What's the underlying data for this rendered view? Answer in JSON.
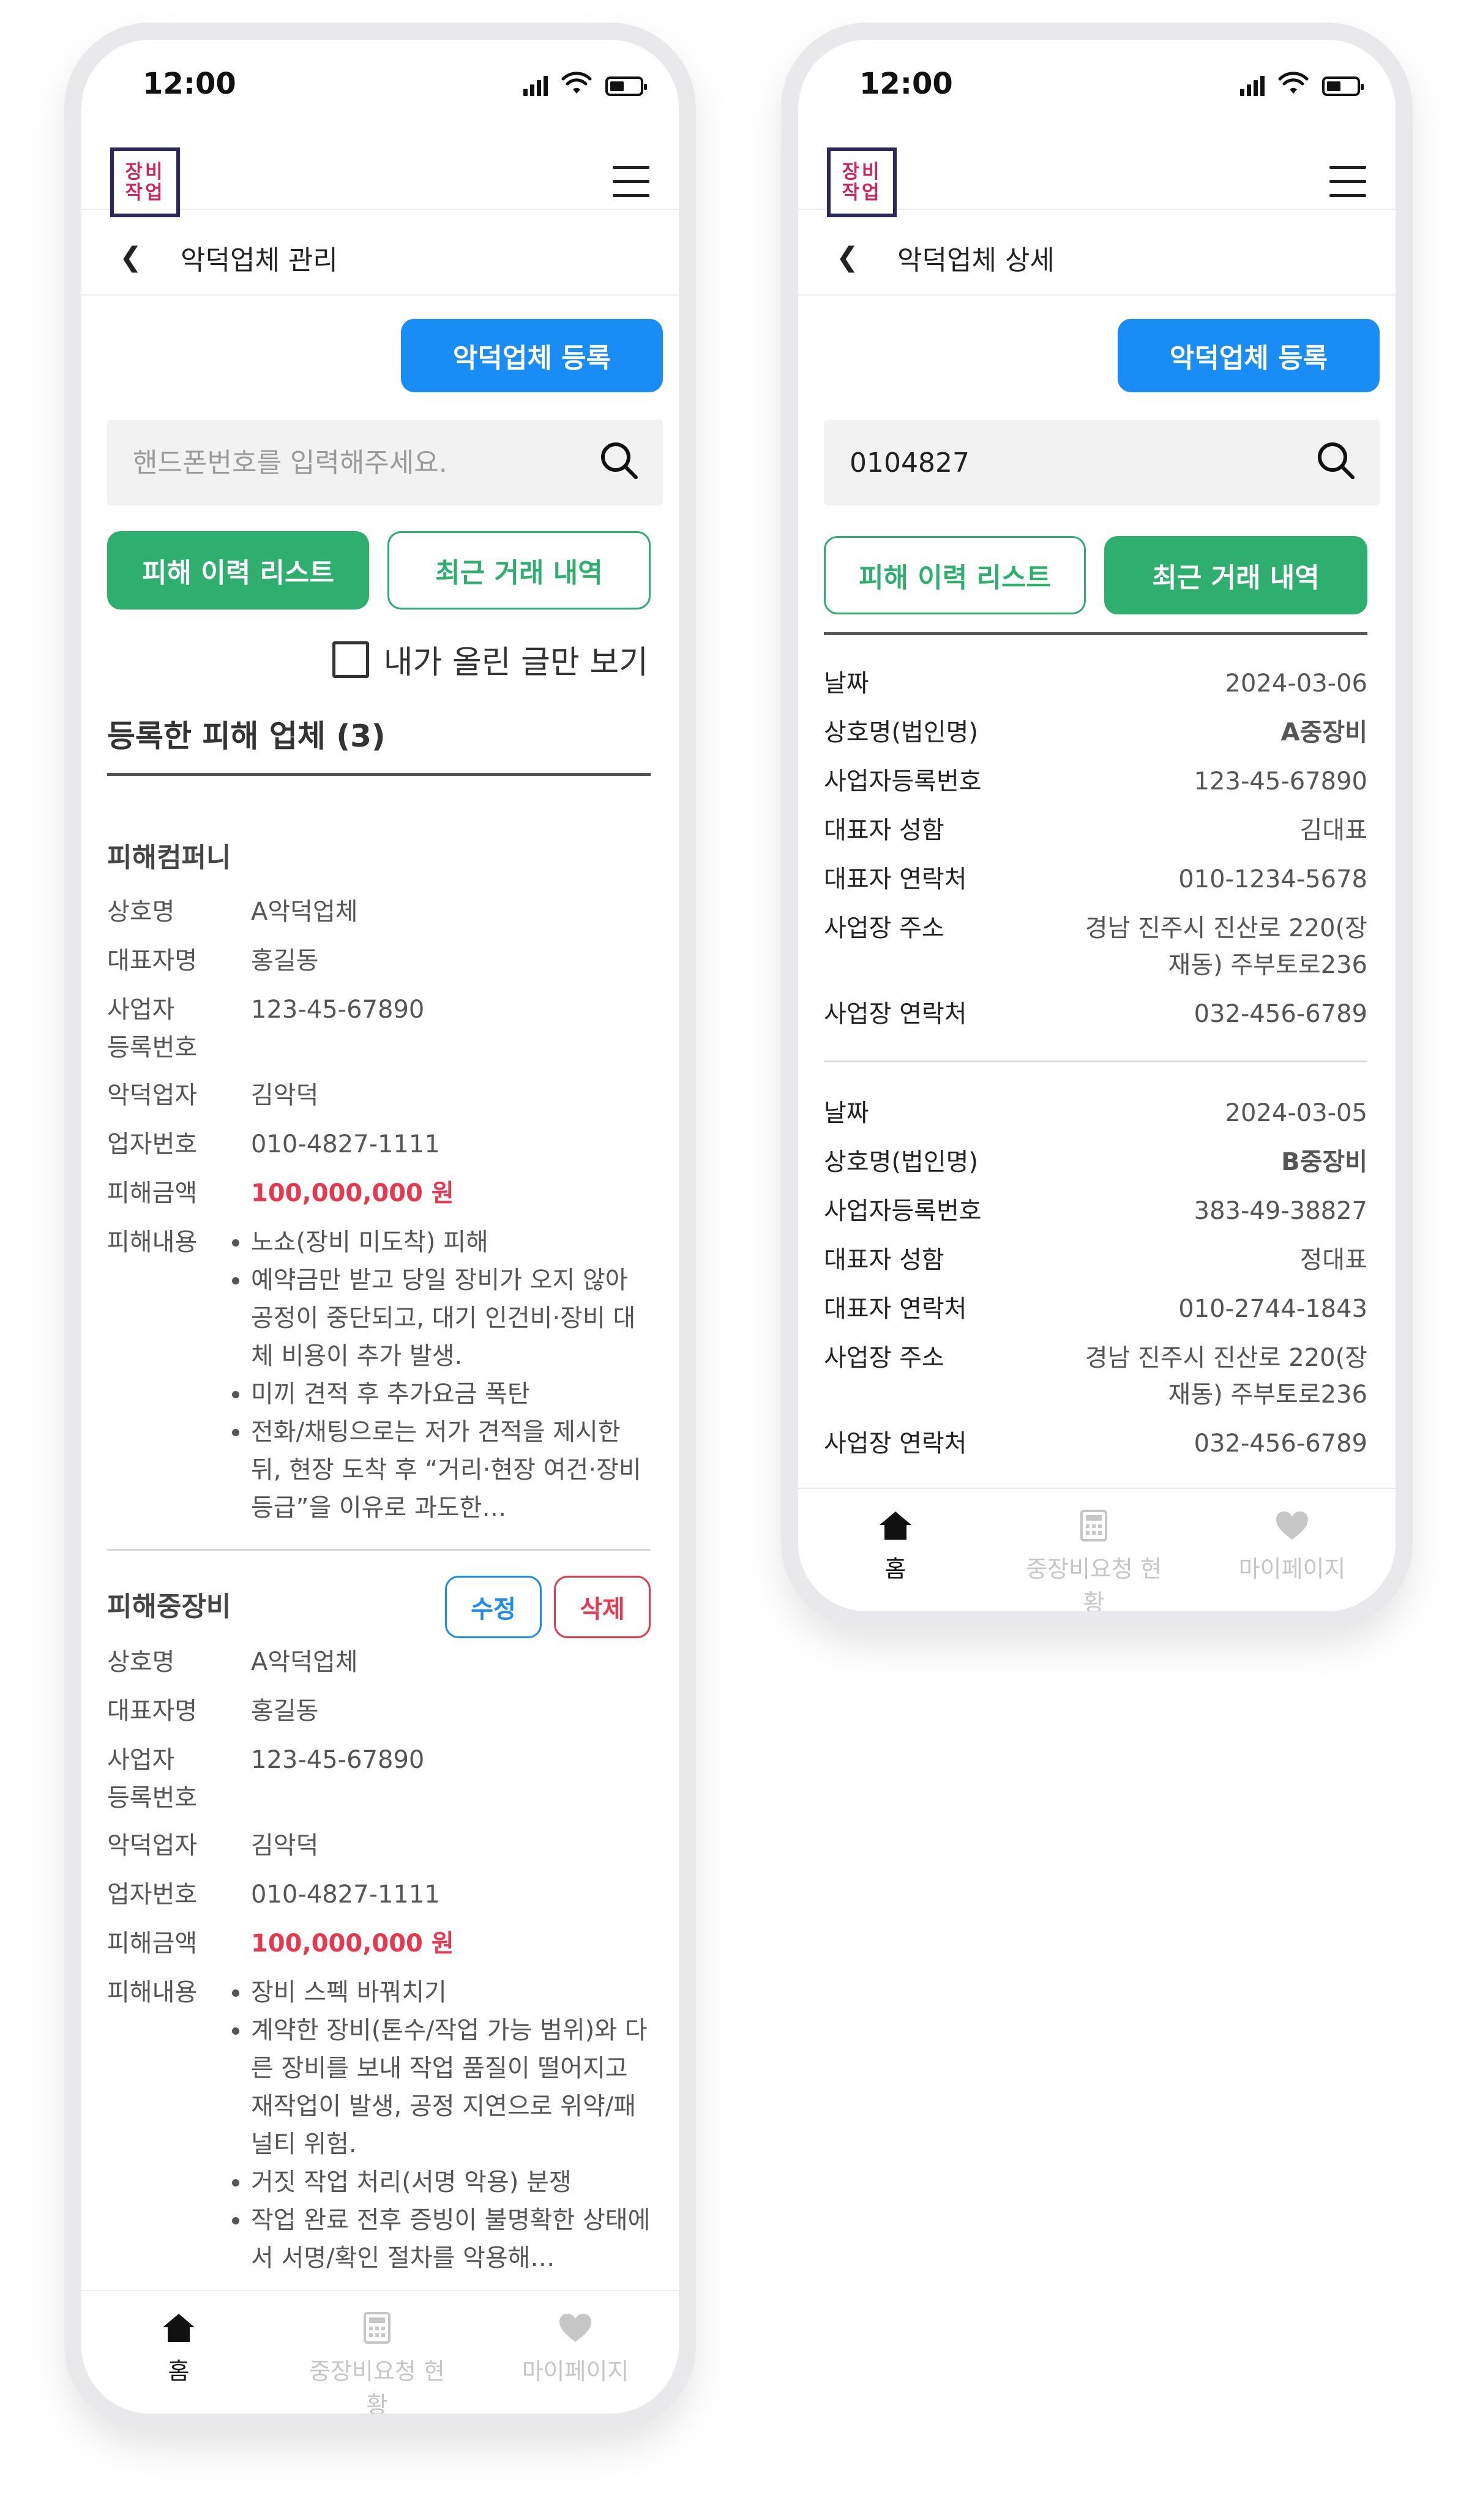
{
  "status": {
    "time": "12:00"
  },
  "logo": {
    "line1": "장비",
    "line2": "작업"
  },
  "left": {
    "title": "악덕업체 관리",
    "register_button": "악덕업체 등록",
    "search_placeholder": "핸드폰번호를 입력해주세요.",
    "tabs": [
      "피해 이력 리스트",
      "최근 거래 내역"
    ],
    "my_posts_only": "내가 올린 글만 보기",
    "section_title": "등록한 피해 업체 (3)",
    "cards": [
      {
        "name": "피해컴퍼니",
        "rows": [
          {
            "label": "상호명",
            "value": "A악덕업체"
          },
          {
            "label": "대표자명",
            "value": "홍길동"
          },
          {
            "label": "사업자\n등록번호",
            "value": "123-45-67890"
          },
          {
            "label": "악덕업자",
            "value": "김악덕"
          },
          {
            "label": "업자번호",
            "value": "010-4827-1111"
          }
        ],
        "amount_label": "피해금액",
        "amount": "100,000,000 원",
        "content_label": "피해내용",
        "content": [
          "노쇼(장비 미도착) 피해",
          "예약금만 받고 당일 장비가 오지 않아 공정이 중단되고, 대기 인건비·장비 대체 비용이 추가 발생.",
          "미끼 견적 후 추가요금 폭탄",
          "전화/채팅으로는 저가 견적을 제시한 뒤, 현장 도착 후 “거리·현장 여건·장비 등급”을 이유로 과도한…"
        ]
      },
      {
        "name": "피해중장비",
        "edit_label": "수정",
        "delete_label": "삭제",
        "rows": [
          {
            "label": "상호명",
            "value": "A악덕업체"
          },
          {
            "label": "대표자명",
            "value": "홍길동"
          },
          {
            "label": "사업자\n등록번호",
            "value": "123-45-67890"
          },
          {
            "label": "악덕업자",
            "value": "김악덕"
          },
          {
            "label": "업자번호",
            "value": "010-4827-1111"
          }
        ],
        "amount_label": "피해금액",
        "amount": "100,000,000 원",
        "content_label": "피해내용",
        "content": [
          "장비 스펙 바꿔치기",
          "계약한 장비(톤수/작업 가능 범위)와 다른 장비를 보내 작업 품질이 떨어지고 재작업이 발생, 공정 지연으로 위약/패널티 위험.",
          "거짓 작업 처리(서명 악용) 분쟁",
          "작업 완료 전후 증빙이 불명확한 상태에서 서명/확인 절차를 악용해…"
        ]
      }
    ]
  },
  "right": {
    "title": "악덕업체 상세",
    "register_button": "악덕업체 등록",
    "search_value": "0104827",
    "tabs": [
      "피해 이력 리스트",
      "최근 거래 내역"
    ],
    "records": [
      {
        "rows": [
          {
            "label": "날짜",
            "value": "2024-03-06"
          },
          {
            "label": "상호명(법인명)",
            "value": "A중장비",
            "bold": true
          },
          {
            "label": "사업자등록번호",
            "value": "123-45-67890"
          },
          {
            "label": "대표자 성함",
            "value": "김대표"
          },
          {
            "label": "대표자 연락처",
            "value": "010-1234-5678"
          },
          {
            "label": "사업장 주소",
            "value": "경남 진주시 진산로 220(장\n재동) 주부토로236"
          },
          {
            "label": "사업장 연락처",
            "value": "032-456-6789"
          }
        ]
      },
      {
        "rows": [
          {
            "label": "날짜",
            "value": "2024-03-05"
          },
          {
            "label": "상호명(법인명)",
            "value": "B중장비",
            "bold": true
          },
          {
            "label": "사업자등록번호",
            "value": "383-49-38827"
          },
          {
            "label": "대표자 성함",
            "value": "정대표"
          },
          {
            "label": "대표자 연락처",
            "value": "010-2744-1843"
          },
          {
            "label": "사업장 주소",
            "value": "경남 진주시 진산로 220(장\n재동) 주부토로236"
          },
          {
            "label": "사업장 연락처",
            "value": "032-456-6789"
          }
        ]
      }
    ]
  },
  "bottom_nav": [
    "홈",
    "중장비요청 현황",
    "마이페이지"
  ],
  "colors": {
    "primary": "#1a8cf6",
    "green": "#2eaf6e",
    "danger": "#e8384f",
    "brand": "#2b2760",
    "brand_text": "#d0245e"
  }
}
